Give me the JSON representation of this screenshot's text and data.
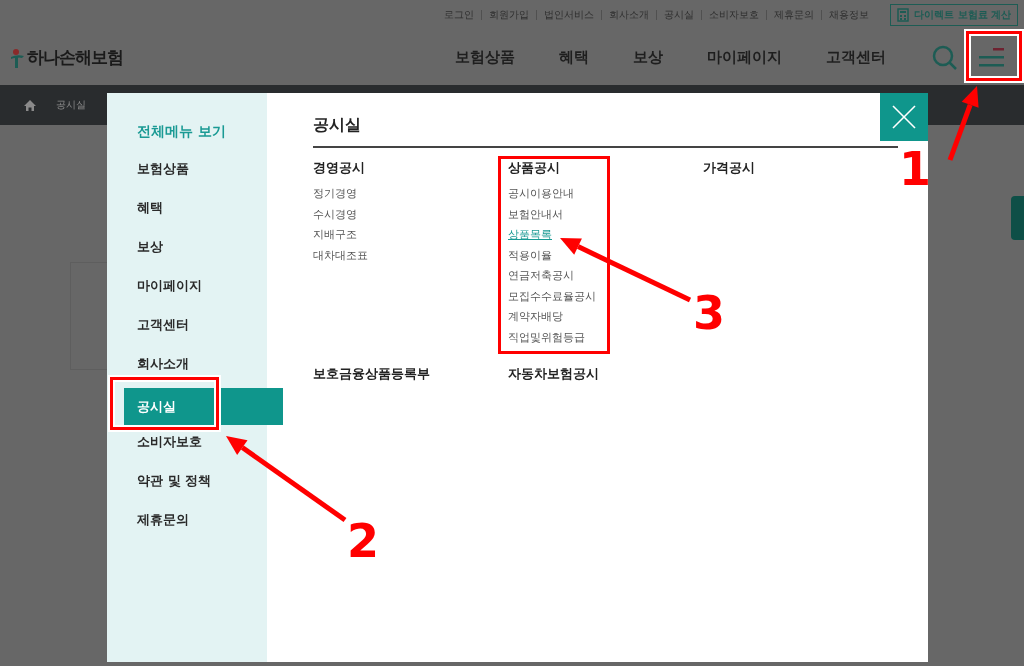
{
  "utility_links": [
    "로그인",
    "회원가입",
    "법인서비스",
    "회사소개",
    "공시실",
    "소비자보호",
    "제휴문의",
    "채용정보"
  ],
  "direct_quote_button": "다이렉트 보험료 계산",
  "logo": "하나손해보험",
  "nav": [
    "보험상품",
    "혜택",
    "보상",
    "마이페이지",
    "고객센터"
  ],
  "breadcrumb": "공시실",
  "menu": {
    "sidebar_title": "전체메뉴 보기",
    "sidebar_items": [
      {
        "label": "보험상품",
        "selected": false
      },
      {
        "label": "혜택",
        "selected": false
      },
      {
        "label": "보상",
        "selected": false
      },
      {
        "label": "마이페이지",
        "selected": false
      },
      {
        "label": "고객센터",
        "selected": false
      },
      {
        "label": "회사소개",
        "selected": false
      },
      {
        "label": "공시실",
        "selected": true
      },
      {
        "label": "소비자보호",
        "selected": false
      },
      {
        "label": "약관 및 정책",
        "selected": false
      },
      {
        "label": "제휴문의",
        "selected": false
      }
    ],
    "title": "공시실",
    "sections": [
      {
        "heading": "경영공시",
        "links": [
          {
            "label": "정기경영",
            "selected": false
          },
          {
            "label": "수시경영",
            "selected": false
          },
          {
            "label": "지배구조",
            "selected": false
          },
          {
            "label": "대차대조표",
            "selected": false
          }
        ]
      },
      {
        "heading": "상품공시",
        "links": [
          {
            "label": "공시이용안내",
            "selected": false
          },
          {
            "label": "보험안내서",
            "selected": false
          },
          {
            "label": "상품목록",
            "selected": true
          },
          {
            "label": "적용이율",
            "selected": false
          },
          {
            "label": "연금저축공시",
            "selected": false
          },
          {
            "label": "모집수수료율공시",
            "selected": false
          },
          {
            "label": "계약자배당",
            "selected": false
          },
          {
            "label": "직업및위험등급",
            "selected": false
          }
        ]
      },
      {
        "heading": "가격공시"
      },
      {
        "heading": "보호금융상품등록부"
      },
      {
        "heading": "자동차보험공시"
      }
    ]
  },
  "annotations": [
    {
      "number": "1"
    },
    {
      "number": "2"
    },
    {
      "number": "3"
    }
  ]
}
